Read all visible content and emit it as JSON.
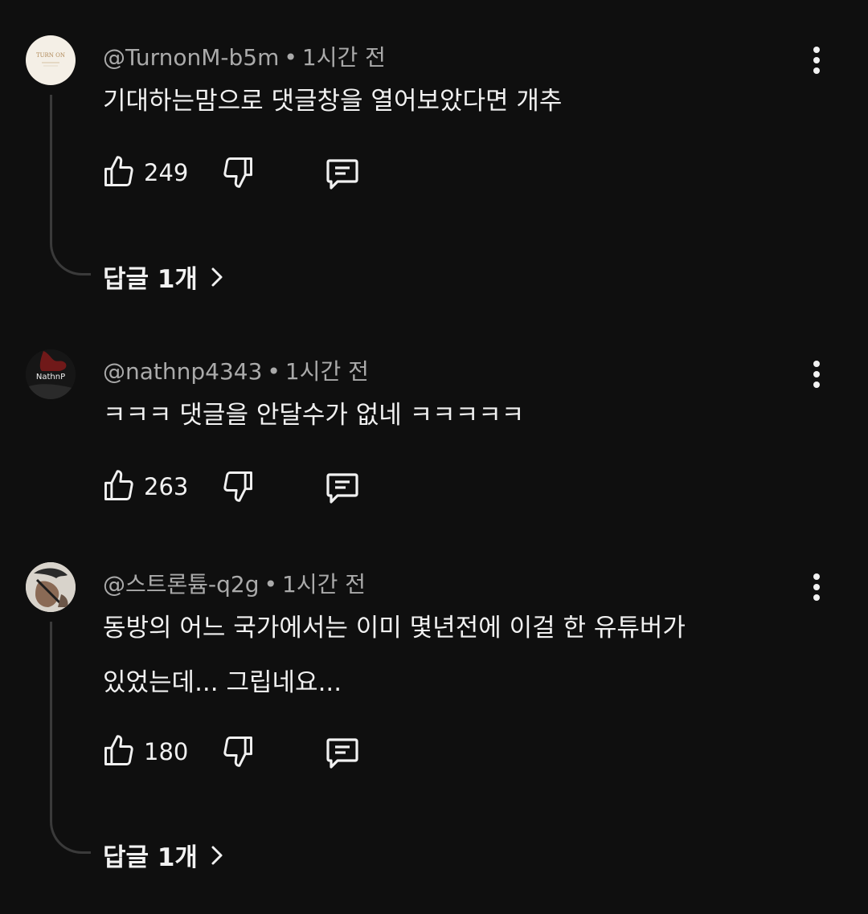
{
  "comments": [
    {
      "author": "@TurnonM-b5m",
      "time": "1시간 전",
      "text_lines": [
        "기대하는맘으로 댓글창을 열어보았다면 개추"
      ],
      "likes": "249",
      "replies_label": "답글 1개",
      "avatar_text": "TURN ON"
    },
    {
      "author": "@nathnp4343",
      "time": "1시간 전",
      "text_lines": [
        "ㅋㅋㅋ 댓글을 안달수가 없네 ㅋㅋㅋㅋㅋ"
      ],
      "likes": "263",
      "avatar_text": "NathnP"
    },
    {
      "author": "@스트론튬-q2g",
      "time": "1시간 전",
      "text_lines": [
        "동방의 어느 국가에서는 이미 몇년전에 이걸 한 유튜버가",
        "있었는데... 그립네요..."
      ],
      "likes": "180",
      "replies_label": "답글 1개"
    }
  ],
  "separator": "•",
  "icons": {
    "like": "thumbs-up-icon",
    "dislike": "thumbs-down-icon",
    "reply": "comment-icon",
    "menu": "more-vert-icon",
    "chevron": "chevron-right-icon"
  },
  "colors": {
    "background": "#0f0f0f",
    "text": "#f1f1f1",
    "meta": "#aaaaaa",
    "thread_line": "#3a3a3a"
  }
}
